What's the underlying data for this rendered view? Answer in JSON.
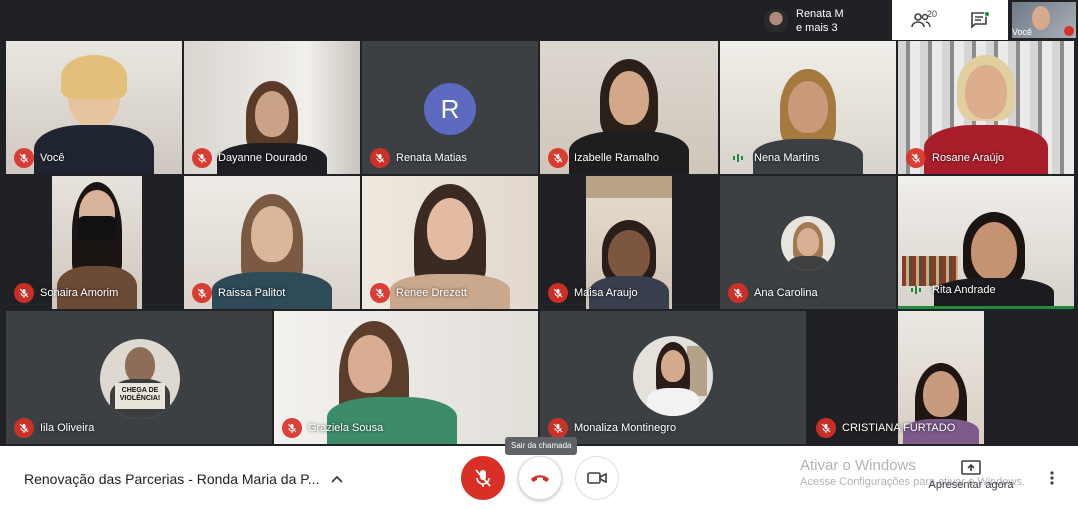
{
  "presenter": {
    "line1": "Renata M",
    "line2": "e mais 3"
  },
  "top_actions": {
    "people_count": "20"
  },
  "self_view": {
    "label": "Você"
  },
  "tiles": [
    {
      "name": "Você"
    },
    {
      "name": "Dayanne Dourado"
    },
    {
      "name": "Renata Matias",
      "initial": "R"
    },
    {
      "name": "Izabelle Ramalho"
    },
    {
      "name": "Nena Martins"
    },
    {
      "name": "Rosane Araújo"
    },
    {
      "name": "Sonaira Amorim"
    },
    {
      "name": "Raissa Palitot"
    },
    {
      "name": "Renee Drezett"
    },
    {
      "name": "Maisa Araujo"
    },
    {
      "name": "Ana Carolina"
    },
    {
      "name": "Rita Andrade"
    },
    {
      "name": "Iila Oliveira",
      "sign_text": "CHEGA DE VIOLÊNCIA!"
    },
    {
      "name": "Graziela Sousa"
    },
    {
      "name": "Monaliza Montinegro"
    },
    {
      "name": "CRISTIANA FURTADO"
    }
  ],
  "bottom": {
    "meeting_title": "Renovação das Parcerias - Ronda Maria da P...",
    "tooltip": "Sair da chamada",
    "present_label": "Apresentar agora"
  },
  "watermark": {
    "line1": "Ativar o Windows",
    "line2": "Acesse Configurações para ativar o Windows."
  },
  "colors": {
    "mic_off": "#d93025",
    "speaking": "#1e8e3e",
    "avatar_r": "#5c6bc0",
    "background": "#202124"
  }
}
